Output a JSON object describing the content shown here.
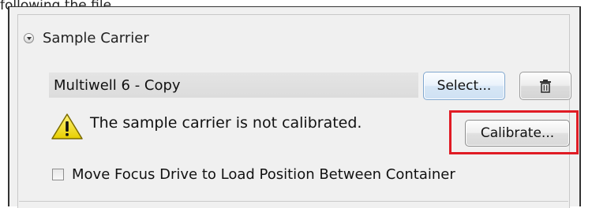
{
  "caption": "following the file.",
  "section": {
    "title": "Sample Carrier",
    "expander_icon": "collapse-circle-icon"
  },
  "carrier": {
    "name": "Multiwell 6 - Copy",
    "select_label": "Select...",
    "delete_icon": "trash-icon"
  },
  "warning": {
    "icon": "warning-triangle-icon",
    "text": "The sample carrier is not calibrated.",
    "calibrate_label": "Calibrate...",
    "highlight_color": "#e01b24"
  },
  "option": {
    "label": "Move Focus Drive to Load Position Between Container",
    "checked": false
  }
}
